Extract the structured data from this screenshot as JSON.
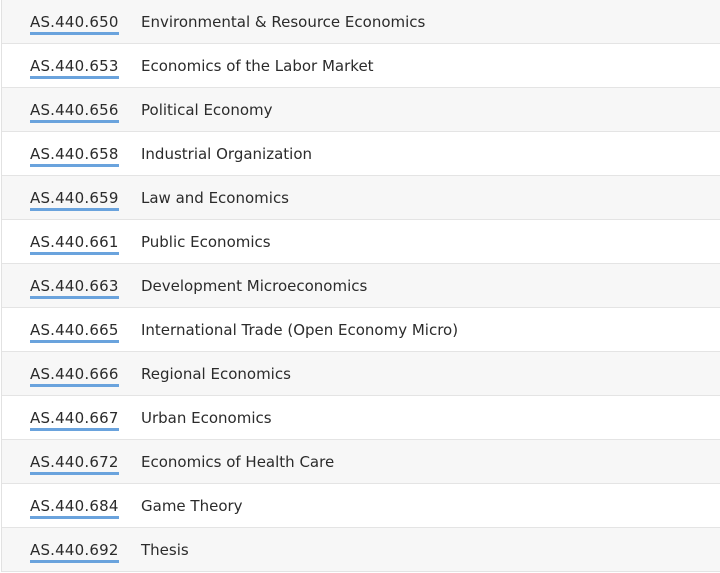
{
  "courses": [
    {
      "code": "AS.440.650",
      "title": "Environmental & Resource Economics"
    },
    {
      "code": "AS.440.653",
      "title": "Economics of the Labor Market"
    },
    {
      "code": "AS.440.656",
      "title": "Political Economy"
    },
    {
      "code": "AS.440.658",
      "title": "Industrial Organization"
    },
    {
      "code": "AS.440.659",
      "title": "Law and Economics"
    },
    {
      "code": "AS.440.661",
      "title": "Public Economics"
    },
    {
      "code": "AS.440.663",
      "title": "Development Microeconomics"
    },
    {
      "code": "AS.440.665",
      "title": "International Trade (Open Economy Micro)"
    },
    {
      "code": "AS.440.666",
      "title": "Regional Economics"
    },
    {
      "code": "AS.440.667",
      "title": "Urban Economics"
    },
    {
      "code": "AS.440.672",
      "title": "Economics of Health Care"
    },
    {
      "code": "AS.440.684",
      "title": "Game Theory"
    },
    {
      "code": "AS.440.692",
      "title": "Thesis"
    }
  ],
  "colors": {
    "link_underline": "#6aa3dd",
    "row_alt_background": "#f7f7f7",
    "row_background": "#ffffff",
    "row_border": "#e4e4e4"
  }
}
